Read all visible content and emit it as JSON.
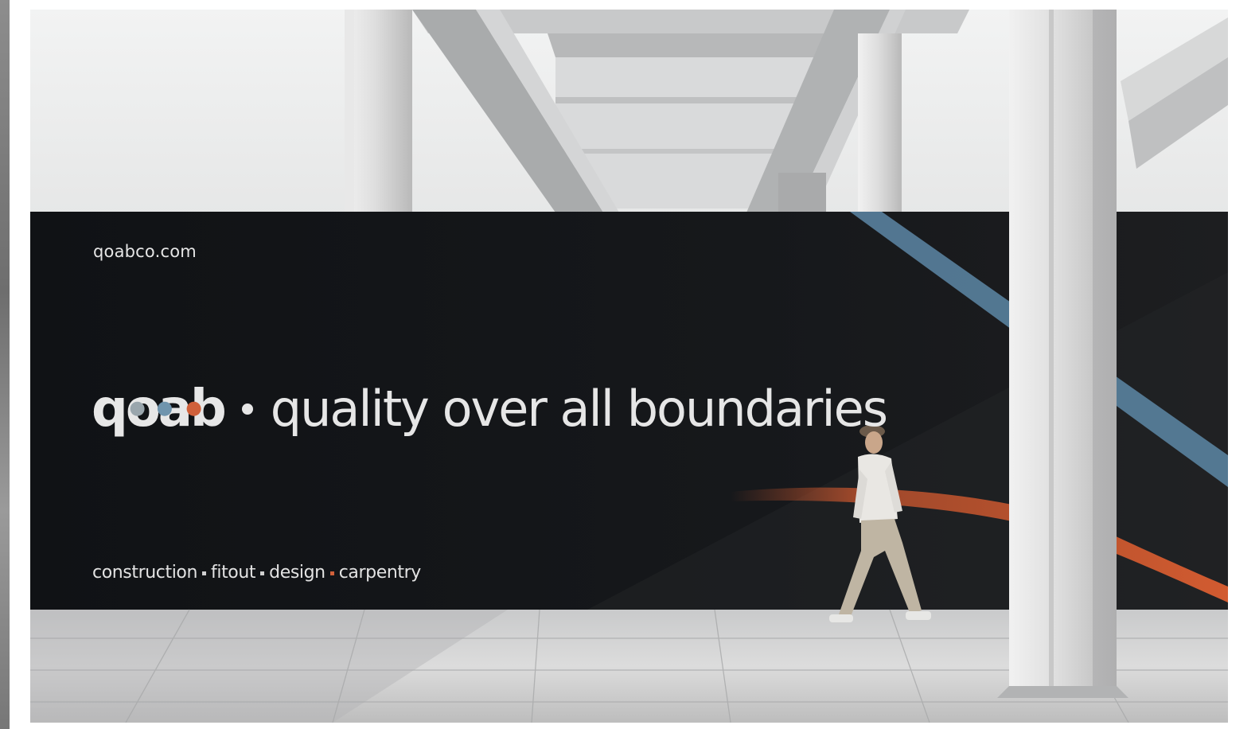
{
  "hoarding": {
    "url": "qoabco.com",
    "logo": {
      "text": "qoab",
      "inner_dot_colors": [
        "#9aa6ad",
        "#6f94ad",
        "#d0603a"
      ]
    },
    "tagline": "quality over all boundaries",
    "services": [
      "construction",
      "fitout",
      "design",
      "carpentry"
    ],
    "separator_colors": [
      "#d0d0d0",
      "#d0d0d0",
      "#d0603a"
    ],
    "colors": {
      "board": "#15171a",
      "accent_blue": "#5d87a6",
      "accent_orange": "#c9562e",
      "text": "#e6e6e6"
    }
  }
}
